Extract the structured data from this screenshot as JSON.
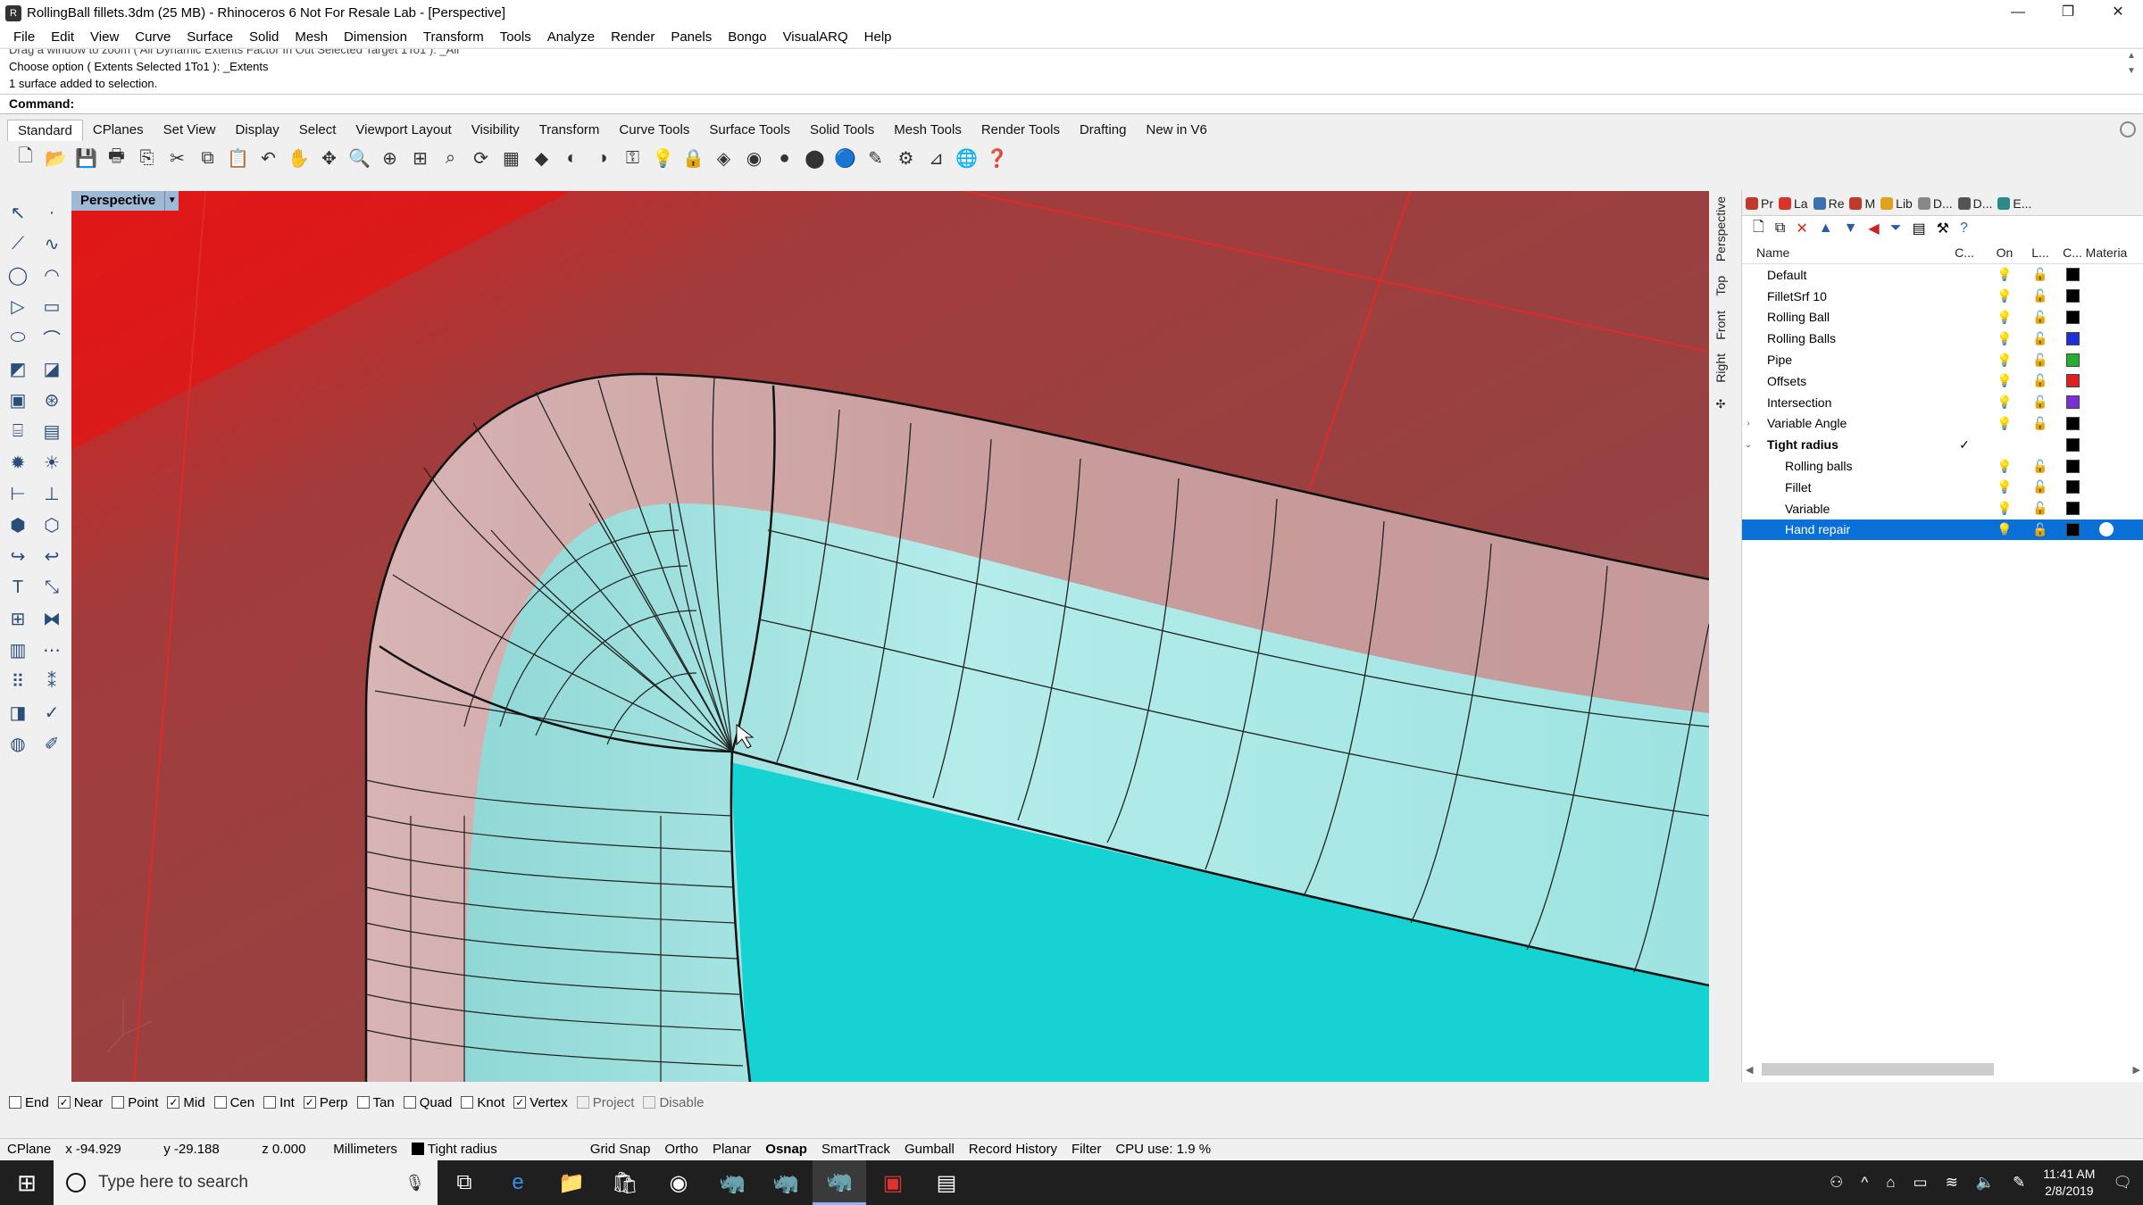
{
  "window": {
    "title": "RollingBall fillets.3dm (25 MB) - Rhinoceros 6 Not For Resale Lab - [Perspective]"
  },
  "menu": [
    "File",
    "Edit",
    "View",
    "Curve",
    "Surface",
    "Solid",
    "Mesh",
    "Dimension",
    "Transform",
    "Tools",
    "Analyze",
    "Render",
    "Panels",
    "Bongo",
    "VisualARQ",
    "Help"
  ],
  "command_history": [
    "Drag a window to zoom ( All  Dynamic  Extents  Factor  In  Out  Selected  Target  1To1 ): _All",
    "Choose option ( Extents  Selected  1To1 ): _Extents",
    "1 surface added to selection."
  ],
  "command_prompt": "Command:",
  "toolbar_tabs": [
    "Standard",
    "CPlanes",
    "Set View",
    "Display",
    "Select",
    "Viewport Layout",
    "Visibility",
    "Transform",
    "Curve Tools",
    "Surface Tools",
    "Solid Tools",
    "Mesh Tools",
    "Render Tools",
    "Drafting",
    "New in V6"
  ],
  "active_toolbar_tab": "Standard",
  "viewport": {
    "name": "Perspective",
    "side_tabs": [
      "Perspective",
      "Top",
      "Front",
      "Right"
    ]
  },
  "panel": {
    "tabs": [
      {
        "label": "Pr",
        "color": "#c0392b"
      },
      {
        "label": "La",
        "color": "#d9342b"
      },
      {
        "label": "Re",
        "color": "#3a6fb0"
      },
      {
        "label": "M",
        "color": "#c0392b"
      },
      {
        "label": "Lib",
        "color": "#e0a020"
      },
      {
        "label": "D...",
        "color": "#888888"
      },
      {
        "label": "D...",
        "color": "#555555"
      },
      {
        "label": "E...",
        "color": "#2a8a8a"
      }
    ],
    "columns": {
      "name": "Name",
      "current": "C...",
      "on": "On",
      "lock": "L...",
      "color": "C...",
      "material": "Materia"
    },
    "layers": [
      {
        "name": "Default",
        "exp": "",
        "current": "",
        "on": "💡",
        "lock": "🔓",
        "color": "#000000",
        "indent": 0
      },
      {
        "name": "FilletSrf 10",
        "exp": "",
        "current": "",
        "on": "💡",
        "lock": "🔓",
        "color": "#000000",
        "indent": 0
      },
      {
        "name": "Rolling Ball",
        "exp": "",
        "current": "",
        "on": "💡",
        "lock": "🔓",
        "color": "#000000",
        "indent": 0
      },
      {
        "name": "Rolling Balls",
        "exp": "",
        "current": "",
        "on": "💡",
        "lock": "🔓",
        "color": "#1f2fd6",
        "indent": 0
      },
      {
        "name": "Pipe",
        "exp": "",
        "current": "",
        "on": "💡",
        "lock": "🔓",
        "color": "#22b033",
        "indent": 0
      },
      {
        "name": "Offsets",
        "exp": "",
        "current": "",
        "on": "💡",
        "lock": "🔓",
        "color": "#e02020",
        "indent": 0
      },
      {
        "name": "Intersection",
        "exp": "",
        "current": "",
        "on": "💡",
        "lock": "🔓",
        "color": "#7a2fd6",
        "indent": 0
      },
      {
        "name": "Variable Angle",
        "exp": "›",
        "current": "",
        "on": "💡",
        "lock": "🔓",
        "color": "#000000",
        "indent": 0
      },
      {
        "name": "Tight radius",
        "exp": "⌄",
        "current": "✓",
        "on": "",
        "lock": "",
        "color": "#000000",
        "indent": 0,
        "bold": true
      },
      {
        "name": "Rolling balls",
        "exp": "",
        "current": "",
        "on": "💡",
        "lock": "🔓",
        "color": "#000000",
        "indent": 1
      },
      {
        "name": "Fillet",
        "exp": "",
        "current": "",
        "on": "💡",
        "lock": "🔓",
        "color": "#000000",
        "indent": 1
      },
      {
        "name": "Variable",
        "exp": "",
        "current": "",
        "on": "💡",
        "lock": "🔓",
        "color": "#000000",
        "indent": 1
      },
      {
        "name": "Hand repair",
        "exp": "",
        "current": "",
        "on": "💡",
        "lock": "🔓",
        "color": "#000000",
        "indent": 1,
        "selected": true
      }
    ]
  },
  "osnaps": [
    {
      "label": "End",
      "checked": false
    },
    {
      "label": "Near",
      "checked": true
    },
    {
      "label": "Point",
      "checked": false
    },
    {
      "label": "Mid",
      "checked": true
    },
    {
      "label": "Cen",
      "checked": false
    },
    {
      "label": "Int",
      "checked": false
    },
    {
      "label": "Perp",
      "checked": true
    },
    {
      "label": "Tan",
      "checked": false
    },
    {
      "label": "Quad",
      "checked": false
    },
    {
      "label": "Knot",
      "checked": false
    },
    {
      "label": "Vertex",
      "checked": true
    },
    {
      "label": "Project",
      "checked": false,
      "dim": true
    },
    {
      "label": "Disable",
      "checked": false,
      "dim": true
    }
  ],
  "status": {
    "cplane": "CPlane",
    "x": "x -94.929",
    "y": "y -29.188",
    "z": "z 0.000",
    "units": "Millimeters",
    "layer": "Tight radius",
    "grid_snap": "Grid Snap",
    "ortho": "Ortho",
    "planar": "Planar",
    "osnap": "Osnap",
    "smarttrack": "SmartTrack",
    "gumball": "Gumball",
    "record_history": "Record History",
    "filter": "Filter",
    "cpu": "CPU use: 1.9 %"
  },
  "taskbar": {
    "search_placeholder": "Type here to search",
    "time": "11:41 AM",
    "date": "2/8/2019"
  }
}
